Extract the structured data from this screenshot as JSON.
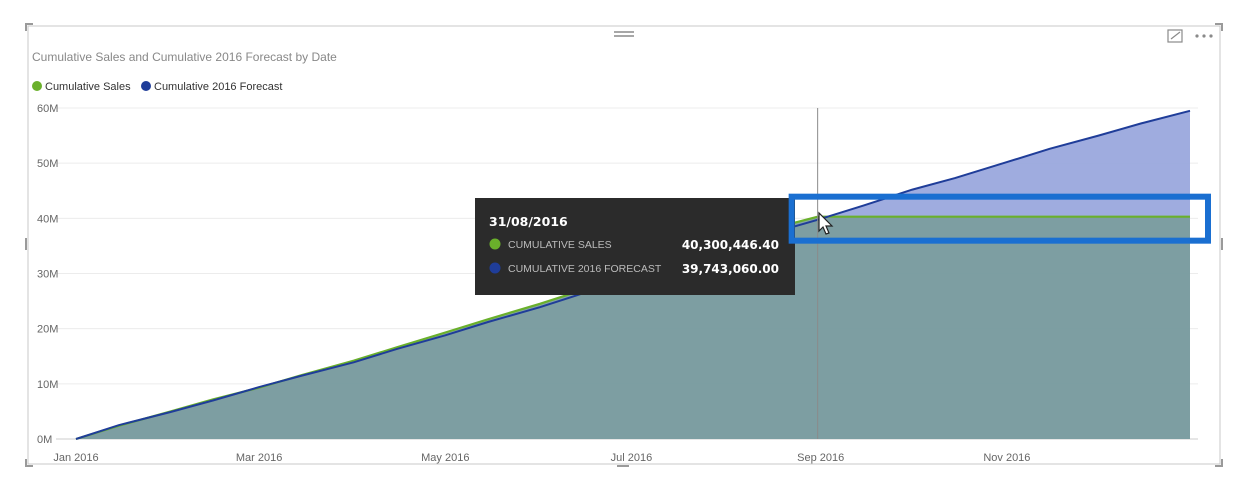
{
  "visual": {
    "title": "Cumulative Sales and Cumulative 2016 Forecast by Date",
    "focus_icon": "focus-mode-icon",
    "more_icon": "more-options-icon",
    "drag_icon": "drag-handle-icon"
  },
  "colors": {
    "sales": "#6ab02b",
    "forecast": "#1f3d99",
    "overlap_fill": "#7a9c9c",
    "forecast_fill": "#9aa8dd",
    "highlight": "#1a6fd1",
    "tooltip_bg": "#2b2b2b"
  },
  "chart_data": {
    "type": "area",
    "title": "Cumulative Sales and Cumulative 2016 Forecast by Date",
    "xlabel": "",
    "ylabel": "",
    "x_range": [
      "2016-01-01",
      "2016-12-31"
    ],
    "ylim": [
      0,
      60000000
    ],
    "y_ticks": [
      0,
      10000000,
      20000000,
      30000000,
      40000000,
      50000000,
      60000000
    ],
    "y_tick_labels": [
      "0M",
      "10M",
      "20M",
      "30M",
      "40M",
      "50M",
      "60M"
    ],
    "x_ticks": [
      "2016-01-01",
      "2016-03-01",
      "2016-05-01",
      "2016-07-01",
      "2016-09-01",
      "2016-11-01"
    ],
    "x_tick_labels": [
      "Jan 2016",
      "Mar 2016",
      "May 2016",
      "Jul 2016",
      "Sep 2016",
      "Nov 2016"
    ],
    "grid": true,
    "legend_position": "top-left",
    "series": [
      {
        "name": "Cumulative Sales",
        "x": [
          "2016-01-01",
          "2016-01-15",
          "2016-02-01",
          "2016-02-15",
          "2016-03-01",
          "2016-03-15",
          "2016-04-01",
          "2016-04-15",
          "2016-05-01",
          "2016-05-15",
          "2016-06-01",
          "2016-06-15",
          "2016-07-01",
          "2016-07-15",
          "2016-08-01",
          "2016-08-15",
          "2016-08-31",
          "2016-09-15",
          "2016-10-01",
          "2016-10-15",
          "2016-11-01",
          "2016-11-15",
          "2016-12-01",
          "2016-12-15",
          "2016-12-31"
        ],
        "values": [
          0,
          2400000,
          5000000,
          7200000,
          9300000,
          11600000,
          14200000,
          16600000,
          19300000,
          21700000,
          24500000,
          27000000,
          29500000,
          32200000,
          35200000,
          38000000,
          40300446.4,
          40300446.4,
          40300446.4,
          40300446.4,
          40300446.4,
          40300446.4,
          40300446.4,
          40300446.4,
          40300446.4
        ]
      },
      {
        "name": "Cumulative 2016 Forecast",
        "x": [
          "2016-01-01",
          "2016-01-15",
          "2016-02-01",
          "2016-02-15",
          "2016-03-01",
          "2016-03-15",
          "2016-04-01",
          "2016-04-15",
          "2016-05-01",
          "2016-05-15",
          "2016-06-01",
          "2016-06-15",
          "2016-07-01",
          "2016-07-15",
          "2016-08-01",
          "2016-08-15",
          "2016-08-31",
          "2016-09-15",
          "2016-10-01",
          "2016-10-15",
          "2016-11-01",
          "2016-11-15",
          "2016-12-01",
          "2016-12-15",
          "2016-12-31"
        ],
        "values": [
          0,
          2500000,
          4900000,
          7000000,
          9400000,
          11500000,
          13900000,
          16300000,
          18800000,
          21200000,
          23900000,
          26400000,
          29000000,
          31800000,
          34500000,
          37200000,
          39743060.0,
          42300000,
          45200000,
          47300000,
          50200000,
          52600000,
          55000000,
          57200000,
          59500000
        ]
      }
    ],
    "hover_x": "2016-08-31",
    "tooltip": {
      "date": "31/08/2016",
      "rows": [
        {
          "label": "CUMULATIVE SALES",
          "value": "40,300,446.40"
        },
        {
          "label": "CUMULATIVE 2016 FORECAST",
          "value": "39,743,060.00"
        }
      ]
    }
  }
}
